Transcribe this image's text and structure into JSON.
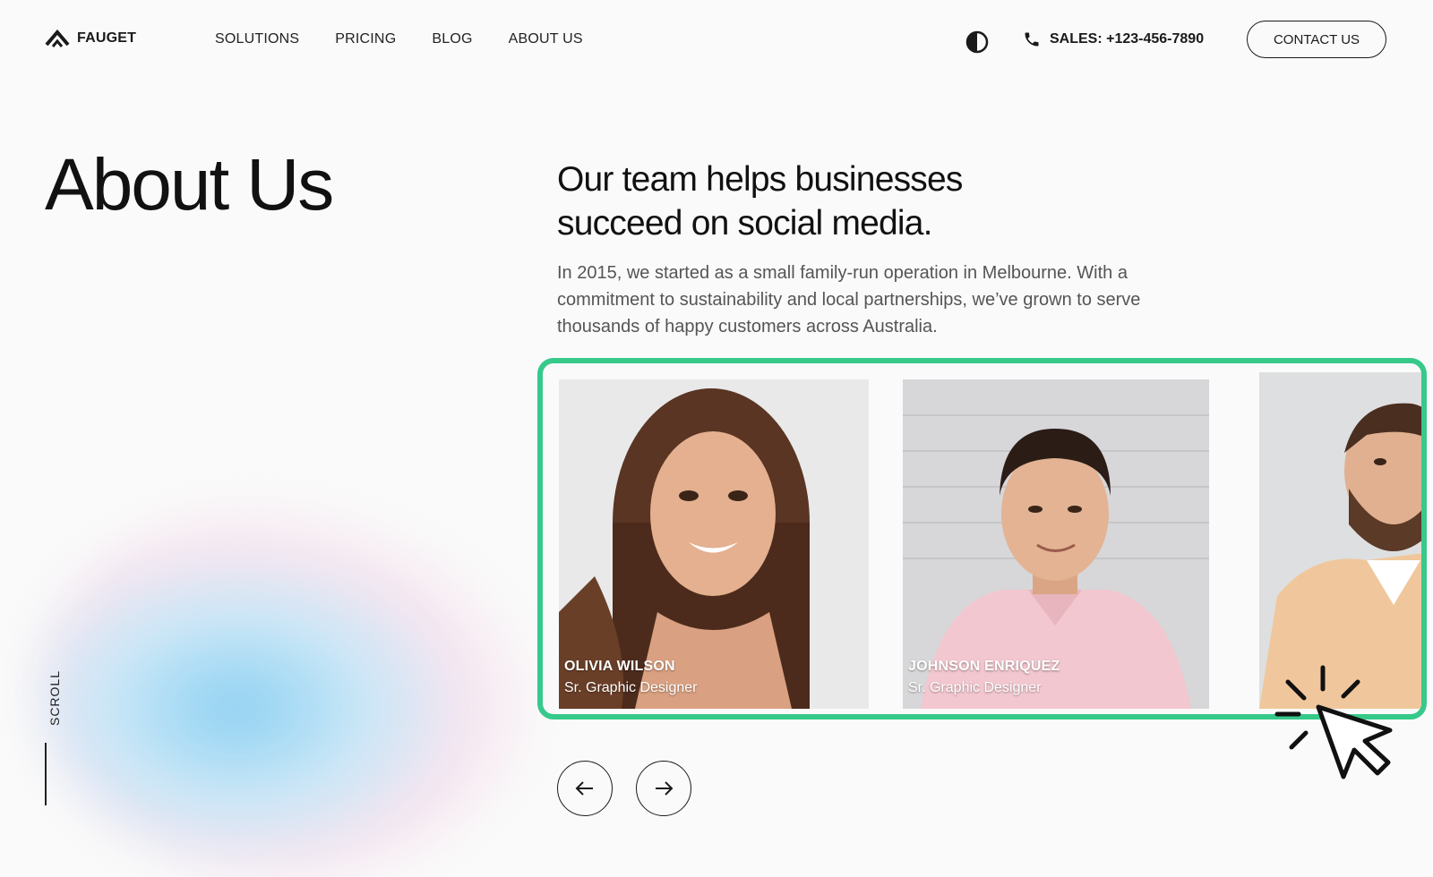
{
  "brand": {
    "name": "FAUGET",
    "icon": "chevron-logo-icon"
  },
  "nav": {
    "items": [
      {
        "label": "SOLUTIONS"
      },
      {
        "label": "PRICING"
      },
      {
        "label": "BLOG"
      },
      {
        "label": "ABOUT US"
      }
    ]
  },
  "header": {
    "theme_icon": "contrast-icon",
    "phone_icon": "phone-icon",
    "sales": "SALES: +123-456-7890",
    "contact_label": "CONTACT US"
  },
  "hero": {
    "title": "About Us",
    "headline": "Our team helps businesses succeed on social media.",
    "intro": "In 2015, we started as a small family-run operation in Melbourne. With a commitment to sustainability and local partnerships, we’ve grown to serve thousands of happy customers across Australia."
  },
  "team": [
    {
      "name": "OLIVIA WILSON",
      "role": "Sr. Graphic Designer"
    },
    {
      "name": "JOHNSON ENRIQUEZ",
      "role": "Sr. Graphic Designer"
    },
    {
      "name": "",
      "role": ""
    }
  ],
  "carousel": {
    "prev_icon": "arrow-left-icon",
    "next_icon": "arrow-right-icon"
  },
  "scroll": {
    "label": "SCROLL"
  },
  "colors": {
    "highlight": "#36c98a",
    "text": "#1a1a1a",
    "muted": "#555555",
    "background": "#fafafa"
  }
}
